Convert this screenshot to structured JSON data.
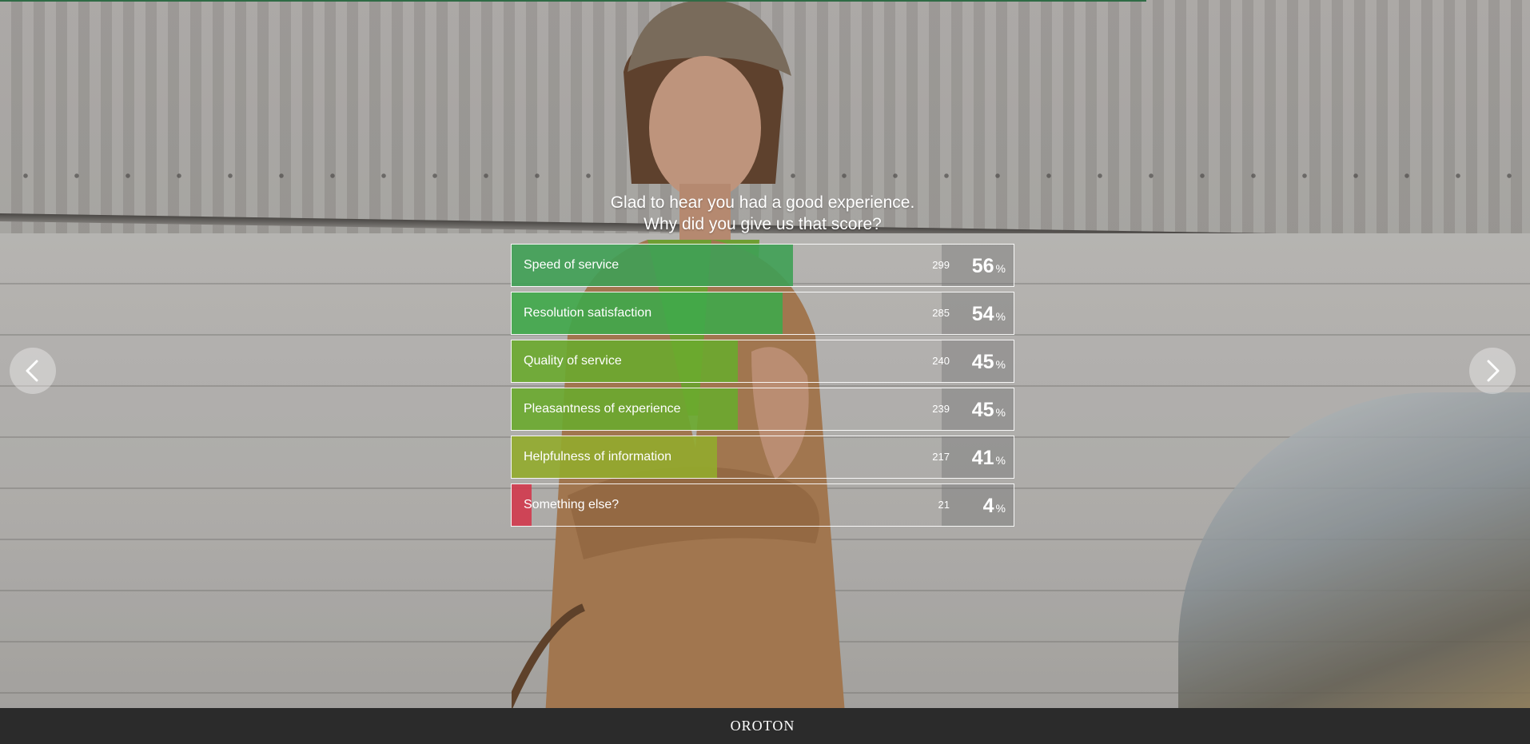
{
  "question": {
    "line1": "Glad to hear you had a good experience.",
    "line2": "Why did you give us that score?"
  },
  "options": [
    {
      "label": "Speed of service",
      "count": "299",
      "percent": "56",
      "percent_sign": "%",
      "fill_fraction": 0.56,
      "color": "#3fa055"
    },
    {
      "label": "Resolution satisfaction",
      "count": "285",
      "percent": "54",
      "percent_sign": "%",
      "fill_fraction": 0.54,
      "color": "#3fa84a"
    },
    {
      "label": "Quality of service",
      "count": "240",
      "percent": "45",
      "percent_sign": "%",
      "fill_fraction": 0.45,
      "color": "#6aaa2e"
    },
    {
      "label": "Pleasantness of experience",
      "count": "239",
      "percent": "45",
      "percent_sign": "%",
      "fill_fraction": 0.45,
      "color": "#6aaa2e"
    },
    {
      "label": "Helpfulness of information",
      "count": "217",
      "percent": "41",
      "percent_sign": "%",
      "fill_fraction": 0.41,
      "color": "#92ab2c"
    },
    {
      "label": "Something else?",
      "count": "21",
      "percent": "4",
      "percent_sign": "%",
      "fill_fraction": 0.04,
      "color": "#d2394c"
    }
  ],
  "navigation": {
    "prev_icon": "chevron-left-icon",
    "next_icon": "chevron-right-icon"
  },
  "footer": {
    "brand": "OROTON"
  },
  "colors": {
    "progress": "#2f6b45",
    "footer_bg": "#2b2b2b"
  }
}
